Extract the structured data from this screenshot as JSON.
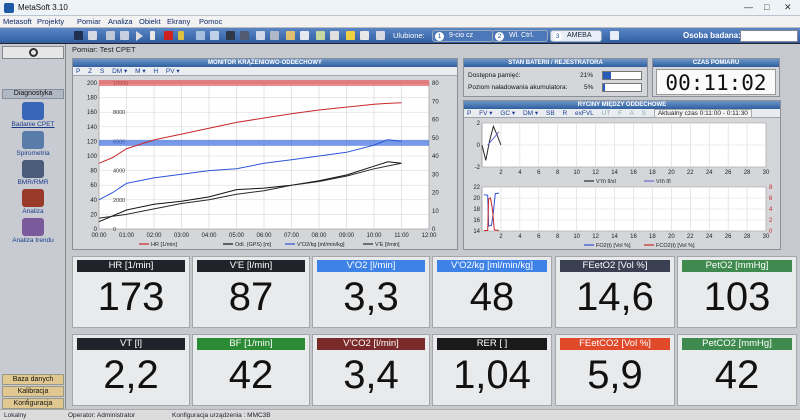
{
  "window": {
    "title": "MetaSoft 3.10",
    "controls": [
      "—",
      "□",
      "✕"
    ]
  },
  "menu": [
    "Metasoft",
    "Projekty",
    "Pomiar",
    "Analiza",
    "Obiekt",
    "Ekrany",
    "Pomoc"
  ],
  "toolbar": {
    "favorites_label": "Ulubione:",
    "favorites": [
      {
        "num": "1",
        "label": "9-cio cz"
      },
      {
        "num": "2",
        "label": "Wl. Ctrl."
      },
      {
        "num": "3",
        "label": "AMEBA"
      }
    ],
    "osoba_label": "Osoba badana:",
    "osoba_value": ""
  },
  "sidebar": {
    "header": "Diagnostyka",
    "items": [
      {
        "label": "Badanie CPET",
        "icon": "cpet-icon",
        "color": "#3a66b8"
      },
      {
        "label": "Spirometria",
        "icon": "spirometry-icon",
        "color": "#5a7ca8"
      },
      {
        "label": "BMR/RMR",
        "icon": "bmr-icon",
        "color": "#4a5c7a"
      },
      {
        "label": "Analiza",
        "icon": "analysis-icon",
        "color": "#9a3a2a"
      },
      {
        "label": "Analiza trendu",
        "icon": "trend-icon",
        "color": "#7a5a9a"
      }
    ],
    "footer": [
      "Baza danych",
      "Kalibracja",
      "Konfiguracja"
    ]
  },
  "tab_title": "Pomiar: Test CPET",
  "monitor": {
    "title": "MONITOR KRĄŻENIOWO-ODDECHOWY",
    "subbar": [
      "P",
      "Z",
      "S",
      "DM ▾",
      "M ▾",
      "H",
      "PV ▾"
    ],
    "chart_data": {
      "type": "line",
      "x_ticks": [
        "00:00",
        "01:00",
        "02:00",
        "03:00",
        "04:00",
        "05:00",
        "06:00",
        "07:00",
        "08:00",
        "09:00",
        "10:00",
        "11:00",
        "12:00"
      ],
      "xlim": [
        0,
        12
      ],
      "left_ticks": [
        0,
        20,
        40,
        60,
        80,
        100,
        120,
        140,
        160,
        180,
        200
      ],
      "ylim_left": [
        0,
        200
      ],
      "inner_ticks": [
        "0",
        "2000",
        "4000",
        "6000",
        "8000",
        "10000"
      ],
      "ylim_inner": [
        0,
        10000
      ],
      "right_ticks": [
        0,
        10,
        20,
        30,
        40,
        50,
        60,
        70,
        80
      ],
      "ylim_right": [
        0,
        80
      ],
      "bands": [
        {
          "y": 200,
          "color": "#e45a5a",
          "axis": "left"
        },
        {
          "y": 118,
          "color": "#3f6fe0",
          "axis": "left"
        }
      ],
      "series": [
        {
          "name": "HR [1/min]",
          "color": "#c8282a",
          "axis": "left",
          "x": [
            0,
            0.5,
            1,
            2,
            3,
            4,
            5,
            6,
            7,
            8,
            9,
            10,
            10.5,
            11
          ],
          "y": [
            90,
            98,
            110,
            122,
            130,
            138,
            146,
            152,
            158,
            163,
            167,
            171,
            172,
            173
          ]
        },
        {
          "name": "Odl. (GPS) [m]",
          "color": "#111111",
          "axis": "inner",
          "x": [
            0,
            1,
            2,
            3,
            4,
            5,
            6,
            7,
            8,
            9,
            10,
            10.5,
            11
          ],
          "y": [
            500,
            1300,
            1700,
            1900,
            2200,
            2700,
            2800,
            3000,
            3300,
            3700,
            4300,
            4600,
            4500
          ]
        },
        {
          "name": "V'O2/kg [ml/min/kg]",
          "color": "#2d55d8",
          "axis": "right",
          "x": [
            0,
            0.5,
            1,
            2,
            3,
            4,
            5,
            6,
            7,
            8,
            9,
            10,
            10.5,
            11
          ],
          "y": [
            16,
            20,
            25,
            28,
            30,
            32,
            33,
            36,
            38,
            40,
            42,
            46,
            49,
            48
          ]
        },
        {
          "name": "V'E [l/min]",
          "color": "#2a2a2a",
          "axis": "right",
          "x": [
            0,
            1,
            2,
            3,
            4,
            5,
            6,
            7,
            8,
            9,
            10,
            11
          ],
          "y": [
            6,
            8,
            11,
            14,
            16,
            19,
            21,
            24,
            26,
            29,
            33,
            36
          ]
        }
      ]
    }
  },
  "battery": {
    "title": "STAN BATERII / REJESTRATORA",
    "rows": [
      {
        "label": "Dostępna pamięć:",
        "value": "21%",
        "fraction": 0.21
      },
      {
        "label": "Poziom naładowania akumulatora:",
        "value": "5%",
        "fraction": 0.05
      }
    ]
  },
  "timer": {
    "title": "CZAS POMIARU",
    "value": "00:11:02"
  },
  "breath": {
    "title": "RYCINY MIĘDZY ODDECHOWE",
    "subbar": [
      "P",
      "FV ▾",
      "GC ▾",
      "DM ▾",
      "SB",
      "R",
      "exFVL",
      "UT",
      "F",
      "A",
      "S"
    ],
    "current_label": "Aktualny czas 0:11:00 - 0:11:30",
    "chart1": {
      "type": "line",
      "x_ticks": [
        "2",
        "4",
        "6",
        "8",
        "10",
        "12",
        "14",
        "16",
        "18",
        "20",
        "22",
        "24",
        "26",
        "28",
        "30"
      ],
      "y_ticks": [
        "-2",
        "0",
        "2"
      ],
      "ylim": [
        -2,
        2
      ],
      "series": [
        {
          "name": "V'(t) [l/s]",
          "color": "#2a2a2a",
          "x": [
            0,
            0.4,
            0.8,
            1.2,
            1.6,
            2
          ],
          "y": [
            0,
            -1.4,
            0.4,
            1.7,
            0.9,
            0
          ]
        },
        {
          "name": "V(t) [l]",
          "color": "#6a6ad0",
          "x": [
            0.6,
            1.8
          ],
          "y": [
            0,
            1.2
          ]
        }
      ]
    },
    "chart2": {
      "type": "line",
      "x_ticks": [
        "2",
        "4",
        "6",
        "8",
        "10",
        "12",
        "14",
        "16",
        "18",
        "20",
        "22",
        "24",
        "26",
        "28",
        "30"
      ],
      "y_left_ticks": [
        "14",
        "16",
        "18",
        "20",
        "22"
      ],
      "ylim_left": [
        14,
        22
      ],
      "y_right_ticks": [
        "0",
        "2",
        "4",
        "6",
        "8"
      ],
      "ylim_right": [
        0,
        8
      ],
      "series": [
        {
          "name": "FO2(t) [Vol %]",
          "color": "#3050d8",
          "axis": "left",
          "x": [
            0.2,
            0.6,
            0.7,
            1.0,
            1.2,
            1.4,
            1.8
          ],
          "y": [
            20.6,
            20.5,
            14.9,
            15.0,
            17.5,
            20.8,
            20.9
          ]
        },
        {
          "name": "FCO2(t) [Vol %]",
          "color": "#c8282a",
          "axis": "right",
          "x": [
            0.2,
            0.6,
            0.7,
            0.9,
            1.1,
            1.3,
            1.8
          ],
          "y": [
            0.1,
            0.1,
            5.8,
            6.0,
            4.0,
            0.2,
            0.1
          ]
        }
      ]
    }
  },
  "tiles": [
    {
      "label": "HR [1/min]",
      "value": "173",
      "color": "#20232a"
    },
    {
      "label": "V'E [l/min]",
      "value": "87",
      "color": "#20232a"
    },
    {
      "label": "V'O2 [l/min]",
      "value": "3,3",
      "color": "#3e82e8"
    },
    {
      "label": "V'O2/kg [ml/min/kg]",
      "value": "48",
      "color": "#3e82e8"
    },
    {
      "label": "FEetO2 [Vol %]",
      "value": "14,6",
      "color": "#3a3f52"
    },
    {
      "label": "PetO2 [mmHg]",
      "value": "103",
      "color": "#3f8a4e"
    },
    {
      "label": "VT [l]",
      "value": "2,2",
      "color": "#20232a"
    },
    {
      "label": "BF [1/min]",
      "value": "42",
      "color": "#2b8a34"
    },
    {
      "label": "V'CO2 [l/min]",
      "value": "3,4",
      "color": "#7a2a2a"
    },
    {
      "label": "RER [ ]",
      "value": "1,04",
      "color": "#1a1a1a"
    },
    {
      "label": "FEetCO2 [Vol %]",
      "value": "5,9",
      "color": "#e04a2a"
    },
    {
      "label": "PetCO2 [mmHg]",
      "value": "42",
      "color": "#3f8a4e"
    }
  ],
  "status": {
    "mode": "Lokalny",
    "operator": "Operator: Administrator",
    "config": "Konfiguracja urządzenia : MMC3B"
  }
}
